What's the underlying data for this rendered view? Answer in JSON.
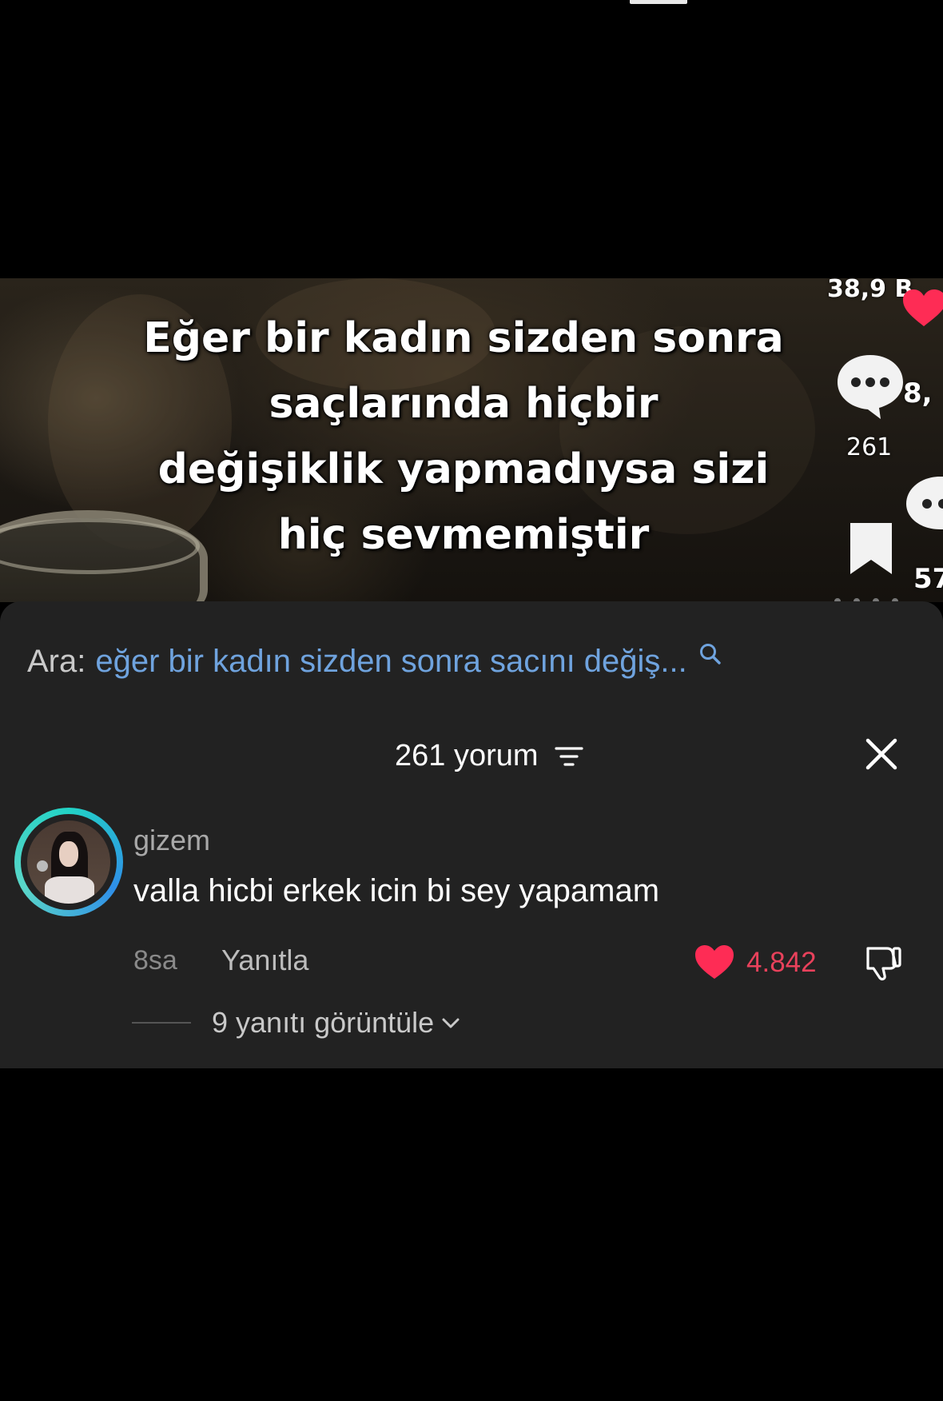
{
  "video": {
    "overlay_lines": [
      "Eğer bir kadın sizden sonra",
      "saçlarında hiçbir",
      "değişiklik yapmadıysa sizi",
      "hiç sevmemiştir"
    ],
    "likes_count": "38,9 B",
    "comments_count": "261",
    "partial_count_1": "8,",
    "partial_count_2": "57"
  },
  "search": {
    "prefix": "Ara:",
    "query": "eğer bir kadın sizden sonra sacını değiş..."
  },
  "comments_header": {
    "count_label": "261 yorum"
  },
  "comment": {
    "username": "gizem",
    "text": "valla hicbi erkek icin bi sey yapamam",
    "time": "8sa",
    "reply_label": "Yanıtla",
    "like_count": "4.842",
    "view_replies_label": "9 yanıtı görüntüle"
  },
  "colors": {
    "panel_bg": "#222222",
    "search_query": "#6fa3de",
    "like_red": "#e8415b",
    "avatar_ring": "#22d3c5"
  },
  "icons": {
    "search": "search-icon",
    "sort": "sort-icon",
    "close": "close-icon",
    "like": "heart-icon",
    "dislike": "thumbs-down-icon",
    "chevron": "chevron-down-icon",
    "bookmark": "bookmark-icon",
    "comment": "comment-bubble-icon"
  }
}
